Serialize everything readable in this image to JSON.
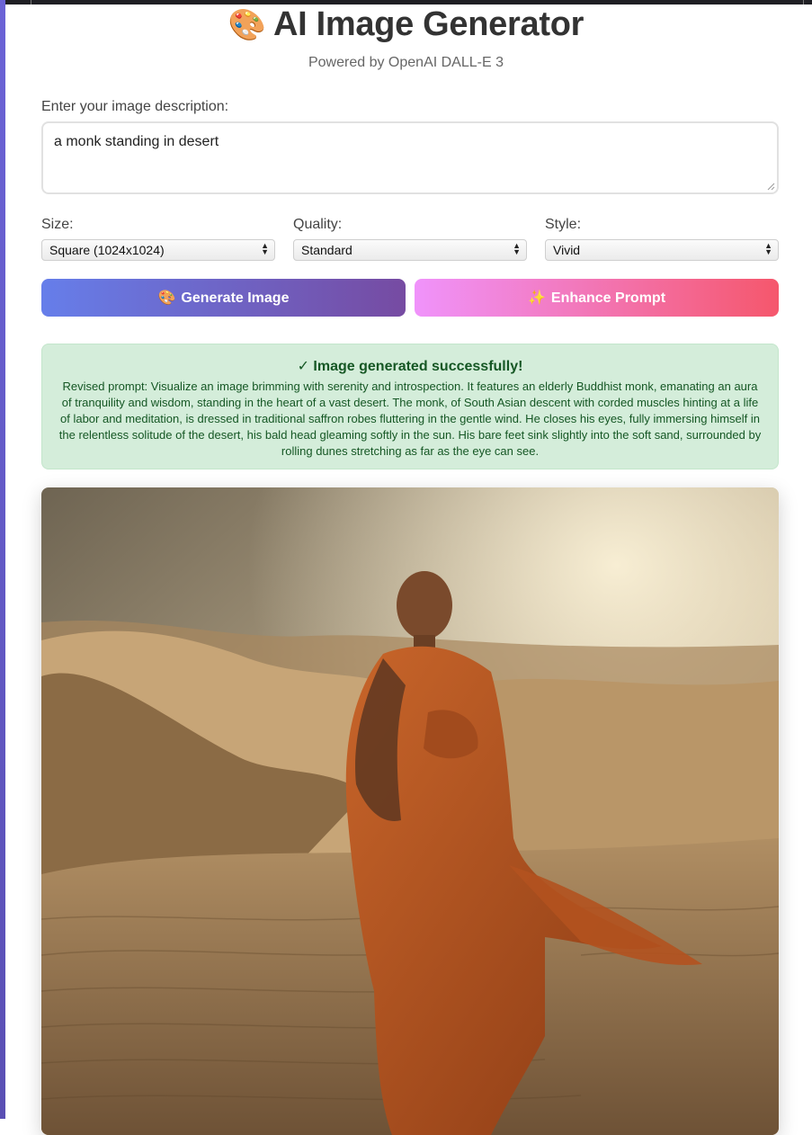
{
  "header": {
    "title_icon": "palette-icon",
    "title": "AI Image Generator",
    "subtitle": "Powered by OpenAI DALL-E 3"
  },
  "prompt": {
    "label": "Enter your image description:",
    "value": "a monk standing in desert"
  },
  "options": {
    "size": {
      "label": "Size:",
      "selected": "Square (1024x1024)"
    },
    "quality": {
      "label": "Quality:",
      "selected": "Standard"
    },
    "style": {
      "label": "Style:",
      "selected": "Vivid"
    }
  },
  "buttons": {
    "generate": {
      "icon": "palette-icon",
      "label": "Generate Image"
    },
    "enhance": {
      "icon": "sparkles-icon",
      "label": "Enhance Prompt"
    }
  },
  "result": {
    "title": "✓ Image generated successfully!",
    "revised_prompt": "Revised prompt: Visualize an image brimming with serenity and introspection. It features an elderly Buddhist monk, emanating an aura of tranquility and wisdom, standing in the heart of a vast desert. The monk, of South Asian descent with corded muscles hinting at a life of labor and meditation, is dressed in traditional saffron robes fluttering in the gentle wind. He closes his eyes, fully immersing himself in the relentless solitude of the desert, his bald head gleaming softly in the sun. His bare feet sink slightly into the soft sand, surrounded by rolling dunes stretching as far as the eye can see."
  },
  "colors": {
    "generate_gradient": [
      "#667eea",
      "#764ba2"
    ],
    "enhance_gradient": [
      "#f093fb",
      "#f5576c"
    ],
    "success_bg": "#d4edda",
    "success_text": "#155724"
  }
}
